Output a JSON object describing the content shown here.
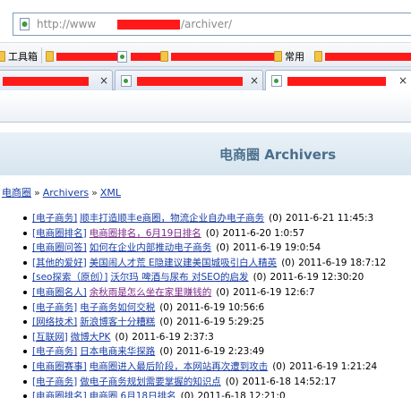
{
  "browser": {
    "address": {
      "prefix": "http://www",
      "suffix": "/archiver/"
    },
    "favorites": [
      {
        "label": "工具箱",
        "kind": "folder"
      },
      {
        "label": "",
        "kind": "redacted"
      },
      {
        "label": "",
        "kind": "redacted"
      },
      {
        "label": "",
        "kind": "redacted"
      },
      {
        "label": "常用",
        "kind": "folder"
      },
      {
        "label": "",
        "kind": "redacted"
      }
    ],
    "tabs": [
      {
        "close": "×",
        "active": false
      },
      {
        "close": "×",
        "active": false
      },
      {
        "close": "×",
        "active": true
      }
    ]
  },
  "page": {
    "site_title": "电商圈  Archivers",
    "breadcrumb": {
      "home": "电商圈",
      "archiver": "Archivers",
      "xml": "XML",
      "separator": "»"
    },
    "threads": [
      {
        "category": "[电子商务]",
        "title": "顺丰打造顺丰e商圈，物流企业自办电子商务",
        "replies": "(0)",
        "date": "2011-6-21 11:45:3",
        "visited": false
      },
      {
        "category": "[电商圈排名]",
        "title": "电商圈排名，6月19日排名",
        "replies": "(0)",
        "date": "2011-6-20 1:0:57",
        "visited": true
      },
      {
        "category": "[电商圈问答]",
        "title": "如何在企业内部推动电子商务",
        "replies": "(0)",
        "date": "2011-6-19 19:0:54",
        "visited": false
      },
      {
        "category": "[其他的爱好]",
        "title": "美国闹人才荒 E隐建议建美国城吸引白人精英",
        "replies": "(0)",
        "date": "2011-6-19 18:7:12",
        "visited": false
      },
      {
        "category": "[seo探索（原创）]",
        "title": "沃尔玛 啤酒与尿布 对SEO的启发",
        "replies": "(0)",
        "date": "2011-6-19 12:30:20",
        "visited": false
      },
      {
        "category": "[电商圈名人]",
        "title": "余秋雨是怎么坐在家里赚钱的",
        "replies": "(0)",
        "date": "2011-6-19 12:6:7",
        "visited": true
      },
      {
        "category": "[电子商务]",
        "title": "电子商务如何交税",
        "replies": "(0)",
        "date": "2011-6-19 10:56:6",
        "visited": false
      },
      {
        "category": "[网络技术]",
        "title": "新浪博客十分糟糕",
        "replies": "(0)",
        "date": "2011-6-19 5:29:25",
        "visited": false
      },
      {
        "category": "[互联网]",
        "title": "微博大PK",
        "replies": "(0)",
        "date": "2011-6-19 2:37:3",
        "visited": false
      },
      {
        "category": "[电子商务]",
        "title": "日本电商来华探路",
        "replies": "(0)",
        "date": "2011-6-19 2:23:49",
        "visited": false
      },
      {
        "category": "[电商圈赛事]",
        "title": "电商圈进入最后阶段，本网站再次遭到攻击",
        "replies": "(0)",
        "date": "2011-6-19 1:21:24",
        "visited": false
      },
      {
        "category": "[电子商务]",
        "title": "做电子商务规划需要掌握的知识点",
        "replies": "(0)",
        "date": "2011-6-18 14:52:17",
        "visited": false
      },
      {
        "category": "[电商圈排名]",
        "title": "电商圈 6月18日排名",
        "replies": "(0)",
        "date": "2011-6-18 12:21:0",
        "visited": false
      }
    ]
  }
}
